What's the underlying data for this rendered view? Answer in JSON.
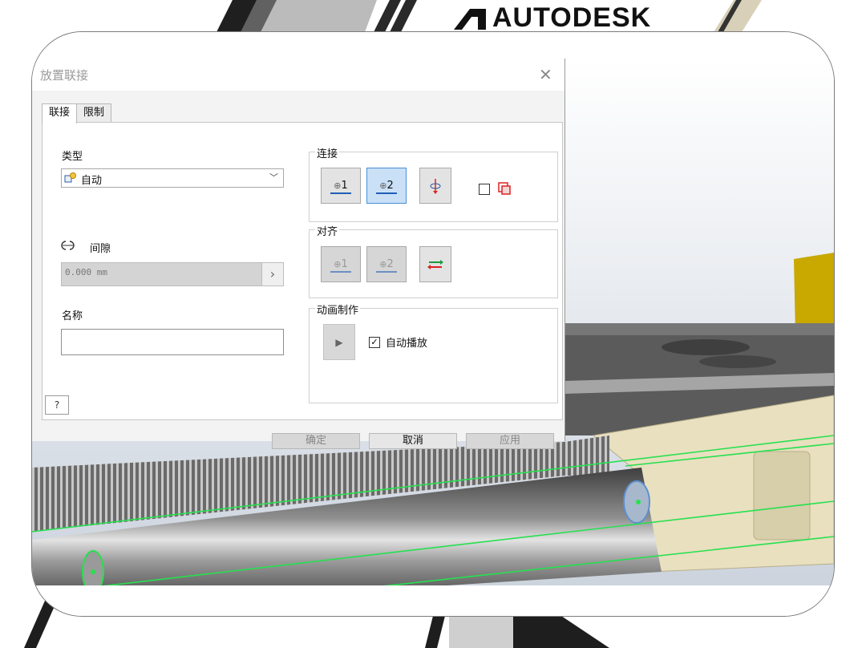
{
  "brand": {
    "logo_text": "AUTODESK"
  },
  "dialog": {
    "title": "放置联接",
    "close_glyph": "✕",
    "tabs": [
      {
        "label": "联接",
        "active": true
      },
      {
        "label": "限制",
        "active": false
      }
    ],
    "type": {
      "label": "类型",
      "selected": "自动",
      "icon": "auto-joint-icon",
      "arrow": "﹀"
    },
    "gap": {
      "label": "间隙",
      "value": "0.000 mm",
      "icon": "gap-icon",
      "arrow": "›"
    },
    "name": {
      "label": "名称",
      "value": ""
    },
    "connect_group": {
      "title": "连接",
      "buttons": [
        {
          "label": "1",
          "icon": "origin-1-icon",
          "selected": false
        },
        {
          "label": "2",
          "icon": "origin-2-icon",
          "selected": true
        },
        {
          "label": "",
          "icon": "flip-component-icon",
          "selected": false
        }
      ],
      "checkbox_checked": false,
      "checkbox_icon": "component-preview-icon"
    },
    "align_group": {
      "title": "对齐",
      "buttons": [
        {
          "label": "1",
          "icon": "align-1-icon",
          "enabled": false
        },
        {
          "label": "2",
          "icon": "align-2-icon",
          "enabled": false
        },
        {
          "label": "",
          "icon": "flip-align-icon",
          "enabled": true
        }
      ]
    },
    "animation_group": {
      "title": "动画制作",
      "play_glyph": "▶",
      "autoplay_label": "自动播放",
      "autoplay_checked": true
    },
    "help_glyph": "?",
    "buttons": {
      "ok": "确定",
      "cancel": "取消",
      "apply": "应用"
    }
  },
  "colors": {
    "accent_blue": "#1f5fb5",
    "selected_fill": "#c9e0f7",
    "model_green": "#27e04f",
    "model_tan": "#e8e0bf",
    "model_yellow": "#c9a800"
  }
}
